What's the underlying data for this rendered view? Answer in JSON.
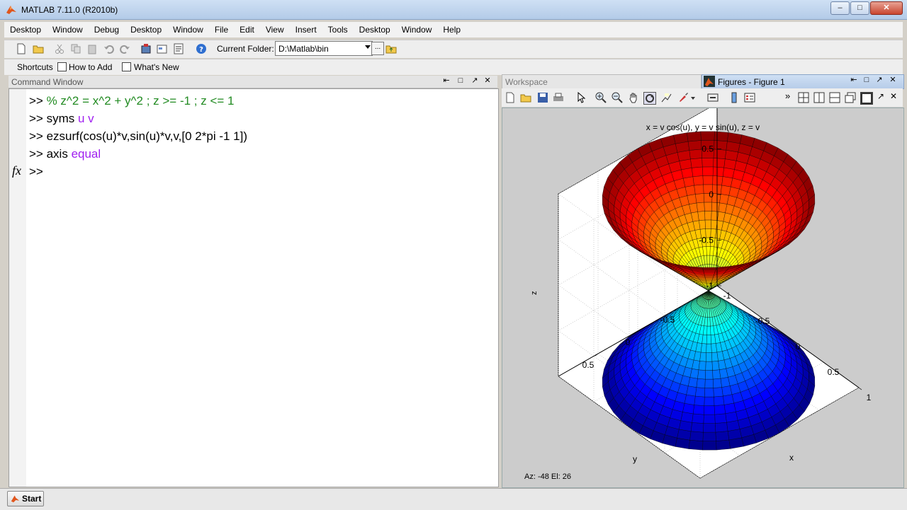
{
  "window": {
    "title": "MATLAB  7.11.0 (R2010b)",
    "buttons": [
      "–",
      "□",
      "✕"
    ]
  },
  "menu": [
    "Desktop",
    "Window",
    "Debug",
    "Desktop",
    "Window",
    "File",
    "Edit",
    "View",
    "Insert",
    "Tools",
    "Desktop",
    "Window",
    "Help"
  ],
  "toolbar": {
    "current_folder_label": "Current Folder:",
    "current_folder_value": "D:\\Matlab\\bin",
    "browse_label": "..."
  },
  "shortcuts": {
    "label": "Shortcuts",
    "items": [
      "How to Add",
      "What's New"
    ]
  },
  "command_window": {
    "title": "Command Window",
    "header_buttons": [
      "⇤",
      "□",
      "↗",
      "✕"
    ],
    "fx": "fx",
    "lines": [
      {
        "prompt": ">> ",
        "text": "% z^2 = x^2 + y^2 ; z >= -1 ; z <= 1"
      },
      {
        "prompt": ">> ",
        "text": "syms ",
        "arg": "u v"
      },
      {
        "prompt": ">> ",
        "text": "ezsurf(cos(u)*v,sin(u)*v,v,[0 2*pi -1 1])"
      },
      {
        "prompt": ">> ",
        "text": "axis ",
        "arg": "equal"
      },
      {
        "prompt": ">> ",
        "text": ""
      }
    ]
  },
  "workspace_tab": {
    "label": "Workspace"
  },
  "figures_tab": {
    "label": "Figures - Figure 1",
    "header_buttons": [
      "⇤",
      "□",
      "↗",
      "✕"
    ]
  },
  "chart_data": {
    "type": "surface",
    "title": "x = v cos(u), y = v sin(u), z = v",
    "xlabel": "x",
    "ylabel": "y",
    "zlabel": "z",
    "x_ticks": [
      1,
      0.5,
      0,
      -0.5,
      -1
    ],
    "y_ticks": [
      0.5,
      0,
      -0.5
    ],
    "z_ticks": [
      1,
      0.5,
      0,
      -0.5,
      -1
    ],
    "xlim": [
      -1,
      1
    ],
    "ylim": [
      -1,
      1
    ],
    "zlim": [
      -1,
      1
    ],
    "u_range": [
      0,
      6.283
    ],
    "v_range": [
      -1,
      1
    ],
    "colormap": "jet",
    "grid": true,
    "view": {
      "az": -48,
      "el": 26
    },
    "view_readout": "Az:  -48 El:   26"
  },
  "statusbar": {
    "start_label": "Start"
  },
  "colors": {
    "prompt_green": "#228b22",
    "keyword_purple": "#a020f0",
    "titlebar": "#b3cbe8"
  }
}
